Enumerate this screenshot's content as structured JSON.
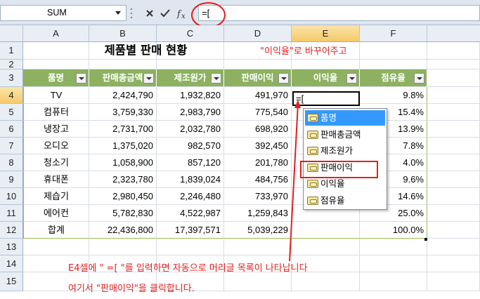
{
  "formula_bar": {
    "name_box": "SUM",
    "formula": "=["
  },
  "columns": [
    "A",
    "B",
    "C",
    "D",
    "E",
    "F"
  ],
  "rows": [
    "1",
    "2",
    "3",
    "4",
    "5",
    "6",
    "7",
    "8",
    "9",
    "10",
    "11",
    "12",
    "13",
    "14",
    "15"
  ],
  "sheet": {
    "title": "제품별 판매 현황",
    "note_top": "\"이익율\"로 바꾸어주고",
    "headers": [
      "품명",
      "판매총금액",
      "제조원가",
      "판매이익",
      "이익율",
      "점유율"
    ],
    "data_rows": [
      {
        "name": "TV",
        "total": "2,424,790",
        "cost": "1,932,820",
        "profit": "491,970",
        "rate": "",
        "share": "9.8%"
      },
      {
        "name": "컴퓨터",
        "total": "3,759,330",
        "cost": "2,983,790",
        "profit": "775,540",
        "rate": "",
        "share": "15.4%"
      },
      {
        "name": "냉장고",
        "total": "2,731,700",
        "cost": "2,032,780",
        "profit": "698,920",
        "rate": "",
        "share": "13.9%"
      },
      {
        "name": "오디오",
        "total": "1,375,020",
        "cost": "982,570",
        "profit": "392,450",
        "rate": "",
        "share": "7.8%"
      },
      {
        "name": "청소기",
        "total": "1,058,900",
        "cost": "857,120",
        "profit": "201,780",
        "rate": "",
        "share": "4.0%"
      },
      {
        "name": "휴대폰",
        "total": "2,323,780",
        "cost": "1,839,024",
        "profit": "484,756",
        "rate": "",
        "share": "9.6%"
      },
      {
        "name": "제습기",
        "total": "2,980,450",
        "cost": "2,246,480",
        "profit": "733,970",
        "rate": "",
        "share": "14.6%"
      },
      {
        "name": "에어컨",
        "total": "5,782,830",
        "cost": "4,522,987",
        "profit": "1,259,843",
        "rate": "",
        "share": "25.0%"
      }
    ],
    "total_row": {
      "name": "합계",
      "total": "22,436,800",
      "cost": "17,397,571",
      "profit": "5,039,229",
      "rate": "",
      "share": "100.0%"
    },
    "active_cell_text": "=["
  },
  "autocomplete": {
    "items": [
      "품명",
      "판매총금액",
      "제조원가",
      "판매이익",
      "이익율",
      "점유율"
    ],
    "highlighted": "품명"
  },
  "notes": {
    "line1": "E4셀에 \" =[ \"를 입력하면 자동으로 머리글 목록이 나타납니다",
    "line2": "여기서 \"판매이익\"을 클릭합니다."
  },
  "colors": {
    "header_green": "#8db160",
    "annotation_red": "#e02020",
    "highlight_blue": "#3399ff"
  }
}
